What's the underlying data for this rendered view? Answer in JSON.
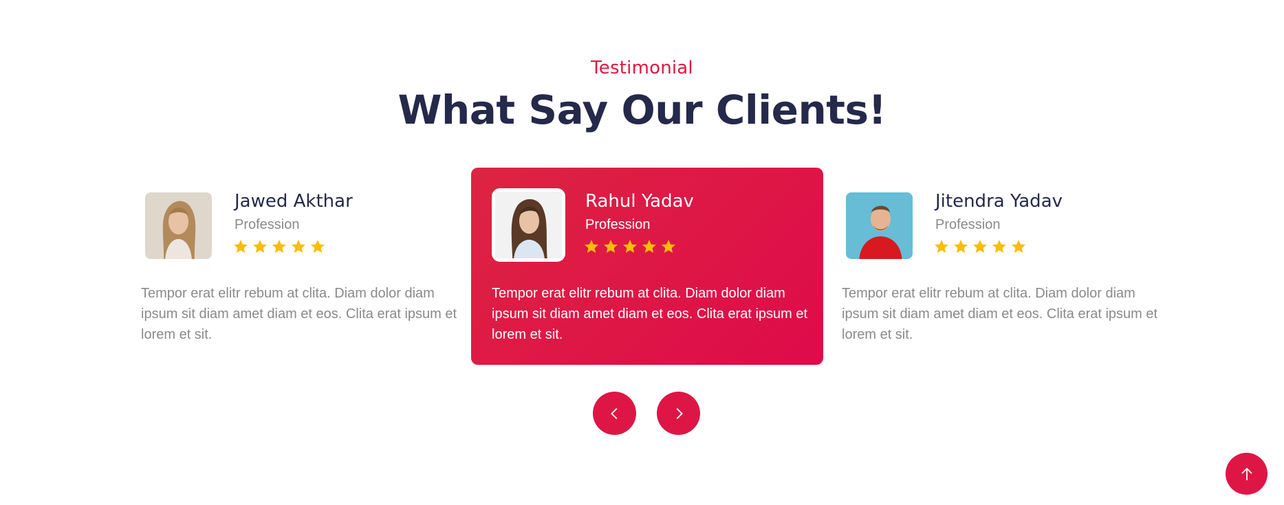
{
  "section": {
    "eyebrow": "Testimonial",
    "heading": "What Say Our Clients!"
  },
  "testimonials": [
    {
      "name": "Jawed Akthar",
      "profession": "Profession",
      "rating": 5,
      "quote": "Tempor erat elitr rebum at clita. Diam dolor diam ipsum sit diam amet diam et eos. Clita erat ipsum et lorem et sit."
    },
    {
      "name": "Rahul Yadav",
      "profession": "Profession",
      "rating": 5,
      "quote": "Tempor erat elitr rebum at clita. Diam dolor diam ipsum sit diam amet diam et eos. Clita erat ipsum et lorem et sit."
    },
    {
      "name": "Jitendra Yadav",
      "profession": "Profession",
      "rating": 5,
      "quote": "Tempor erat elitr rebum at clita. Diam dolor diam ipsum sit diam amet diam et eos. Clita erat ipsum et lorem et sit."
    }
  ],
  "icons": {
    "prev": "chevron-left-icon",
    "next": "chevron-right-icon",
    "back_to_top": "arrow-up-icon",
    "star": "star-icon"
  },
  "colors": {
    "accent": "#de1646",
    "heading": "#25294a",
    "muted": "#8a8a8a",
    "star": "#fbbc05"
  }
}
